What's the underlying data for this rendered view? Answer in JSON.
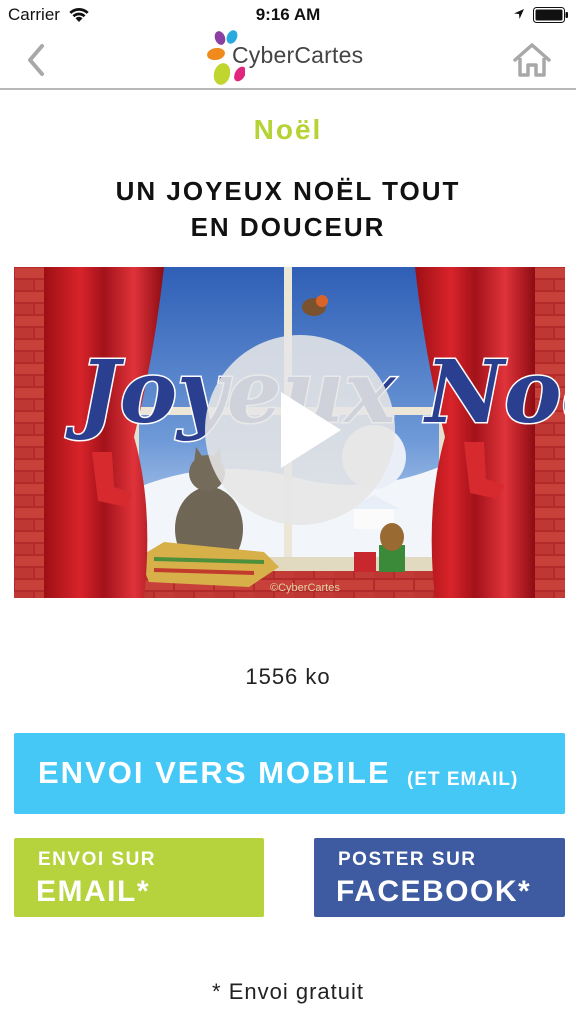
{
  "status_bar": {
    "carrier": "Carrier",
    "time": "9:16 AM",
    "icons": [
      "wifi-icon",
      "location-icon",
      "battery-icon"
    ]
  },
  "nav": {
    "brand": "CyberCartes",
    "back_icon": "chevron-left-icon",
    "home_icon": "home-icon",
    "logo_colors": [
      "#f08a1c",
      "#c0d62f",
      "#8b3fa0",
      "#e0267d",
      "#2aa9e0"
    ]
  },
  "content": {
    "category": "Noël",
    "title_line1": "UN JOYEUX NOËL TOUT",
    "title_line2": "EN DOUCEUR",
    "preview_text": "Joyeux Noël",
    "watermark": "©CyberCartes",
    "file_size": "1556 ko"
  },
  "actions": {
    "mobile_main": "ENVOI VERS MOBILE",
    "mobile_sub": "(ET EMAIL)",
    "email_small": "ENVOI SUR",
    "email_big": "EMAIL*",
    "facebook_small": "POSTER SUR",
    "facebook_big": "FACEBOOK*"
  },
  "footnote": "* Envoi gratuit",
  "colors": {
    "accent_green": "#b5d334",
    "mobile_blue": "#45c8f6",
    "facebook_blue": "#3e5aa0",
    "email_green": "#b6d23d"
  }
}
